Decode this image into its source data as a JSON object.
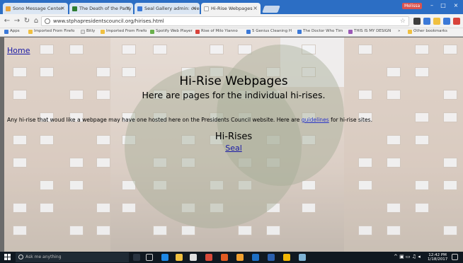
{
  "browser": {
    "tabs": [
      {
        "label": "Sono Message Center",
        "fav": "#e8a33b"
      },
      {
        "label": "The Death of the Party -",
        "fav": "#2e7d32"
      },
      {
        "label": "Seal Gallery admin: over",
        "fav": "#3b79d8"
      },
      {
        "label": "Hi-Rise Webpages",
        "fav": "#f5f5f5",
        "active": true
      }
    ],
    "user_label": "Melissa",
    "url": "www.stphapresidentscouncil.org/hirises.html",
    "bookmarks": [
      {
        "label": "Apps",
        "icon": "b"
      },
      {
        "label": "Imported From Firefo",
        "icon": "y"
      },
      {
        "label": "Bitly",
        "icon": "w"
      },
      {
        "label": "Imported From Firefo",
        "icon": "y"
      },
      {
        "label": "Spotify Web Player",
        "icon": "g"
      },
      {
        "label": "Rise of Milo Yianno",
        "icon": "r"
      },
      {
        "label": "5 Genius Cleaning H",
        "icon": "b"
      },
      {
        "label": "The Doctor Who Tim",
        "icon": "b"
      },
      {
        "label": "THIS IS MY DESIGN",
        "icon": "p"
      },
      {
        "label": "»",
        "icon": "none"
      },
      {
        "label": "Other bookmarks",
        "icon": "y"
      }
    ]
  },
  "page": {
    "home_link": "Home",
    "title": "Hi-Rise Webpages",
    "subtitle": "Here are pages for the individual hi-rises.",
    "intro_before": "Any hi-rise that woud like a webpage may have one hosted here on the Presidents Council website. Here are ",
    "intro_link": "guidelines",
    "intro_after": " for hi-rise sites.",
    "section_title": "Hi-Rises",
    "seal_link": "Seal"
  },
  "taskbar": {
    "search_placeholder": "Ask me anything",
    "time": "12:42 PM",
    "date": "1/18/2017"
  }
}
